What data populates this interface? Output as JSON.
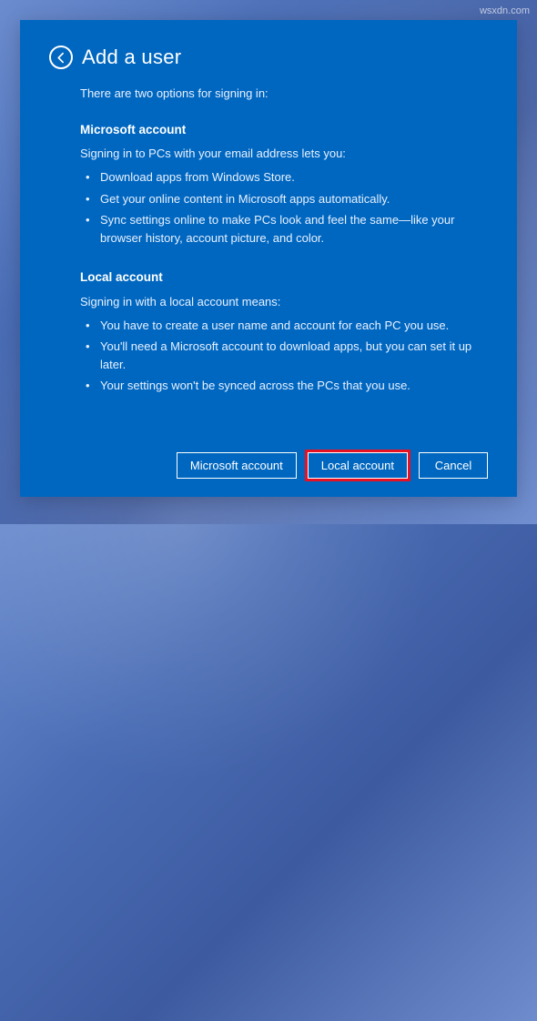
{
  "watermark": "wsxdn.com",
  "header": {
    "title": "Add a user"
  },
  "intro": "There are two options for signing in:",
  "sections": {
    "ms": {
      "heading": "Microsoft account",
      "text": "Signing in to PCs with your email address lets you:",
      "bullets": [
        "Download apps from Windows Store.",
        "Get your online content in Microsoft apps automatically.",
        "Sync settings online to make PCs look and feel the same—like your browser history, account picture, and color."
      ]
    },
    "local": {
      "heading": "Local account",
      "text": "Signing in with a local account means:",
      "bullets": [
        "You have to create a user name and account for each PC you use.",
        "You'll need a Microsoft account to download apps, but you can set it up later.",
        "Your settings won't be synced across the PCs that you use."
      ]
    }
  },
  "buttons": {
    "ms": "Microsoft account",
    "local": "Local account",
    "cancel": "Cancel"
  }
}
